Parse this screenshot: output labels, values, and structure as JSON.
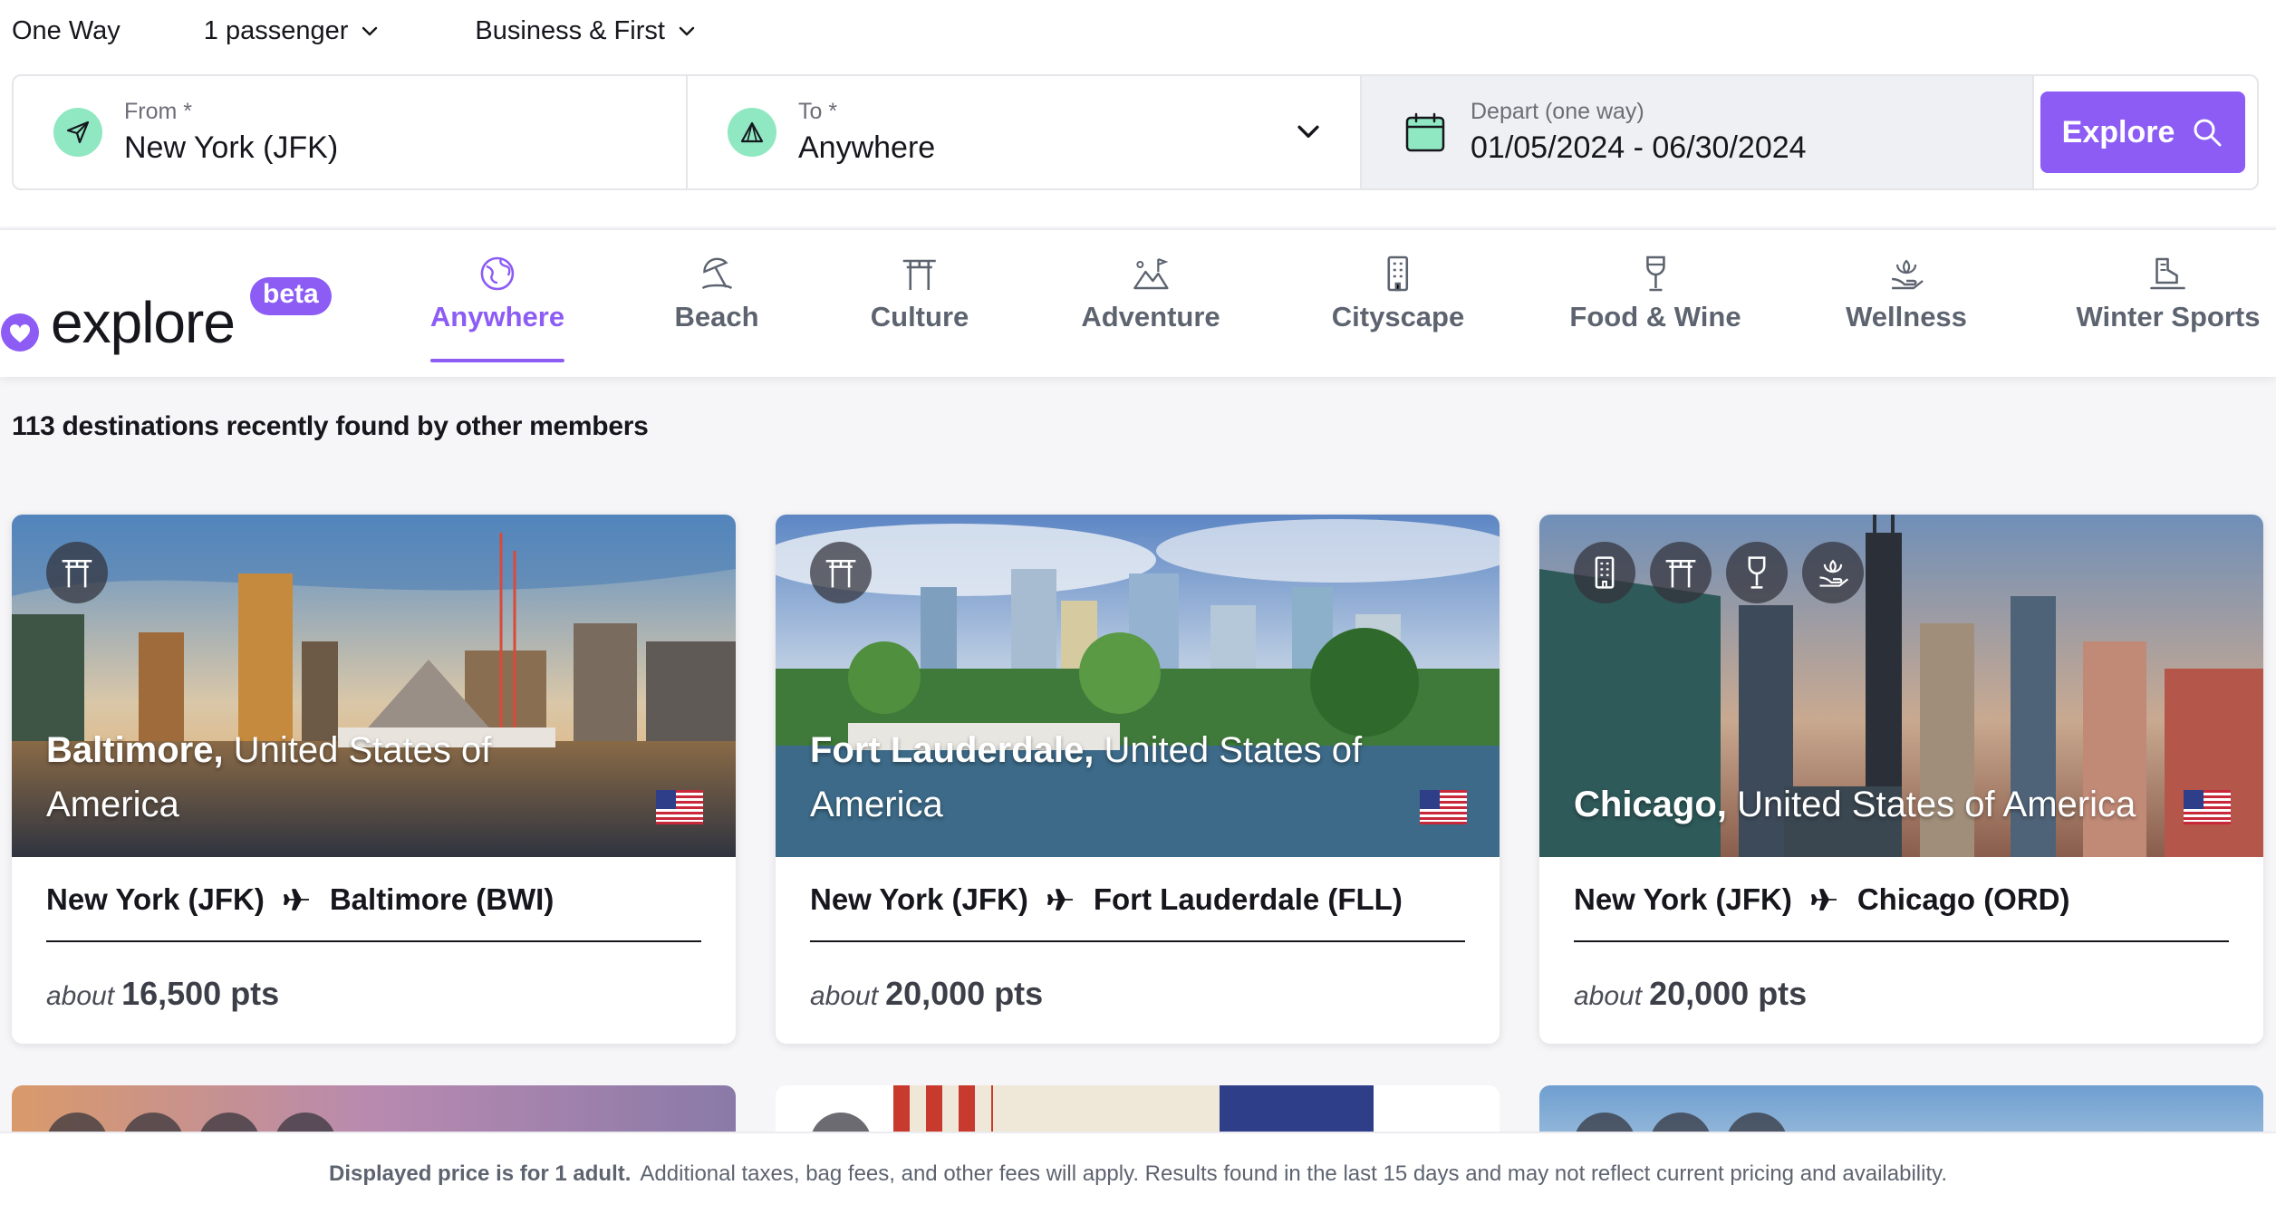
{
  "options": {
    "trip_type": "One Way",
    "passengers": "1 passenger",
    "cabin": "Business & First"
  },
  "search": {
    "from_label": "From *",
    "from_value": "New York (JFK)",
    "to_label": "To *",
    "to_value": "Anywhere",
    "depart_label": "Depart (one way)",
    "depart_value": "01/05/2024 - 06/30/2024",
    "explore_label": "Explore"
  },
  "logo": {
    "word": "explore",
    "badge": "beta"
  },
  "categories": [
    {
      "label": "Anywhere",
      "icon": "globe-icon",
      "active": true
    },
    {
      "label": "Beach",
      "icon": "beach-umbrella-icon"
    },
    {
      "label": "Culture",
      "icon": "torii-gate-icon"
    },
    {
      "label": "Adventure",
      "icon": "mountain-icon"
    },
    {
      "label": "Cityscape",
      "icon": "building-icon"
    },
    {
      "label": "Food & Wine",
      "icon": "wine-glass-icon"
    },
    {
      "label": "Wellness",
      "icon": "lotus-hand-icon"
    },
    {
      "label": "Winter Sports",
      "icon": "ski-boot-icon"
    }
  ],
  "results": {
    "count_text": "113 destinations recently found by other members"
  },
  "cards": [
    {
      "city": "Baltimore,",
      "country": "United States of America",
      "badges": [
        "torii-gate-icon"
      ],
      "origin": "New York (JFK)",
      "destination": "Baltimore (BWI)",
      "price_prefix": "about",
      "price": "16,500 pts"
    },
    {
      "city": "Fort Lauderdale,",
      "country": "United States of America",
      "badges": [
        "torii-gate-icon"
      ],
      "origin": "New York (JFK)",
      "destination": "Fort Lauderdale (FLL)",
      "price_prefix": "about",
      "price": "20,000 pts"
    },
    {
      "city": "Chicago,",
      "country": "United States of America",
      "badges": [
        "building-icon",
        "torii-gate-icon",
        "wine-glass-icon",
        "lotus-hand-icon"
      ],
      "origin": "New York (JFK)",
      "destination": "Chicago (ORD)",
      "price_prefix": "about",
      "price": "20,000 pts"
    }
  ],
  "footer": {
    "bold": "Displayed price is for 1 adult.",
    "text": "Additional taxes, bag fees, and other fees will apply. Results found in the last 15 days and may not reflect current pricing and availability."
  },
  "colors": {
    "accent": "#8c5cf5",
    "mint": "#8fe8c2"
  }
}
